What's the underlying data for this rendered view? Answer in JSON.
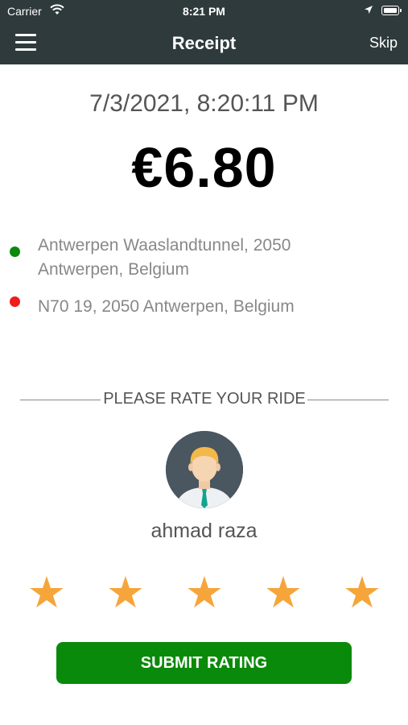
{
  "status_bar": {
    "carrier": "Carrier",
    "time": "8:21 PM"
  },
  "header": {
    "title": "Receipt",
    "skip_label": "Skip",
    "background_color": "#2f3a3c"
  },
  "receipt": {
    "datetime": "7/3/2021, 8:20:11 PM",
    "amount": "€6.80"
  },
  "route": {
    "pickup": "Antwerpen Waaslandtunnel, 2050 Antwerpen, Belgium",
    "dropoff": "N70 19, 2050 Antwerpen, Belgium",
    "pickup_color": "#0a8a0a",
    "dropoff_color": "#ef1c1c"
  },
  "rating": {
    "heading": "PLEASE RATE YOUR RIDE",
    "driver_name": "ahmad raza",
    "stars_filled": 5,
    "stars_total": 5,
    "star_color": "#f6a53b",
    "submit_label": "SUBMIT RATING",
    "submit_color": "#0a8a0a"
  }
}
